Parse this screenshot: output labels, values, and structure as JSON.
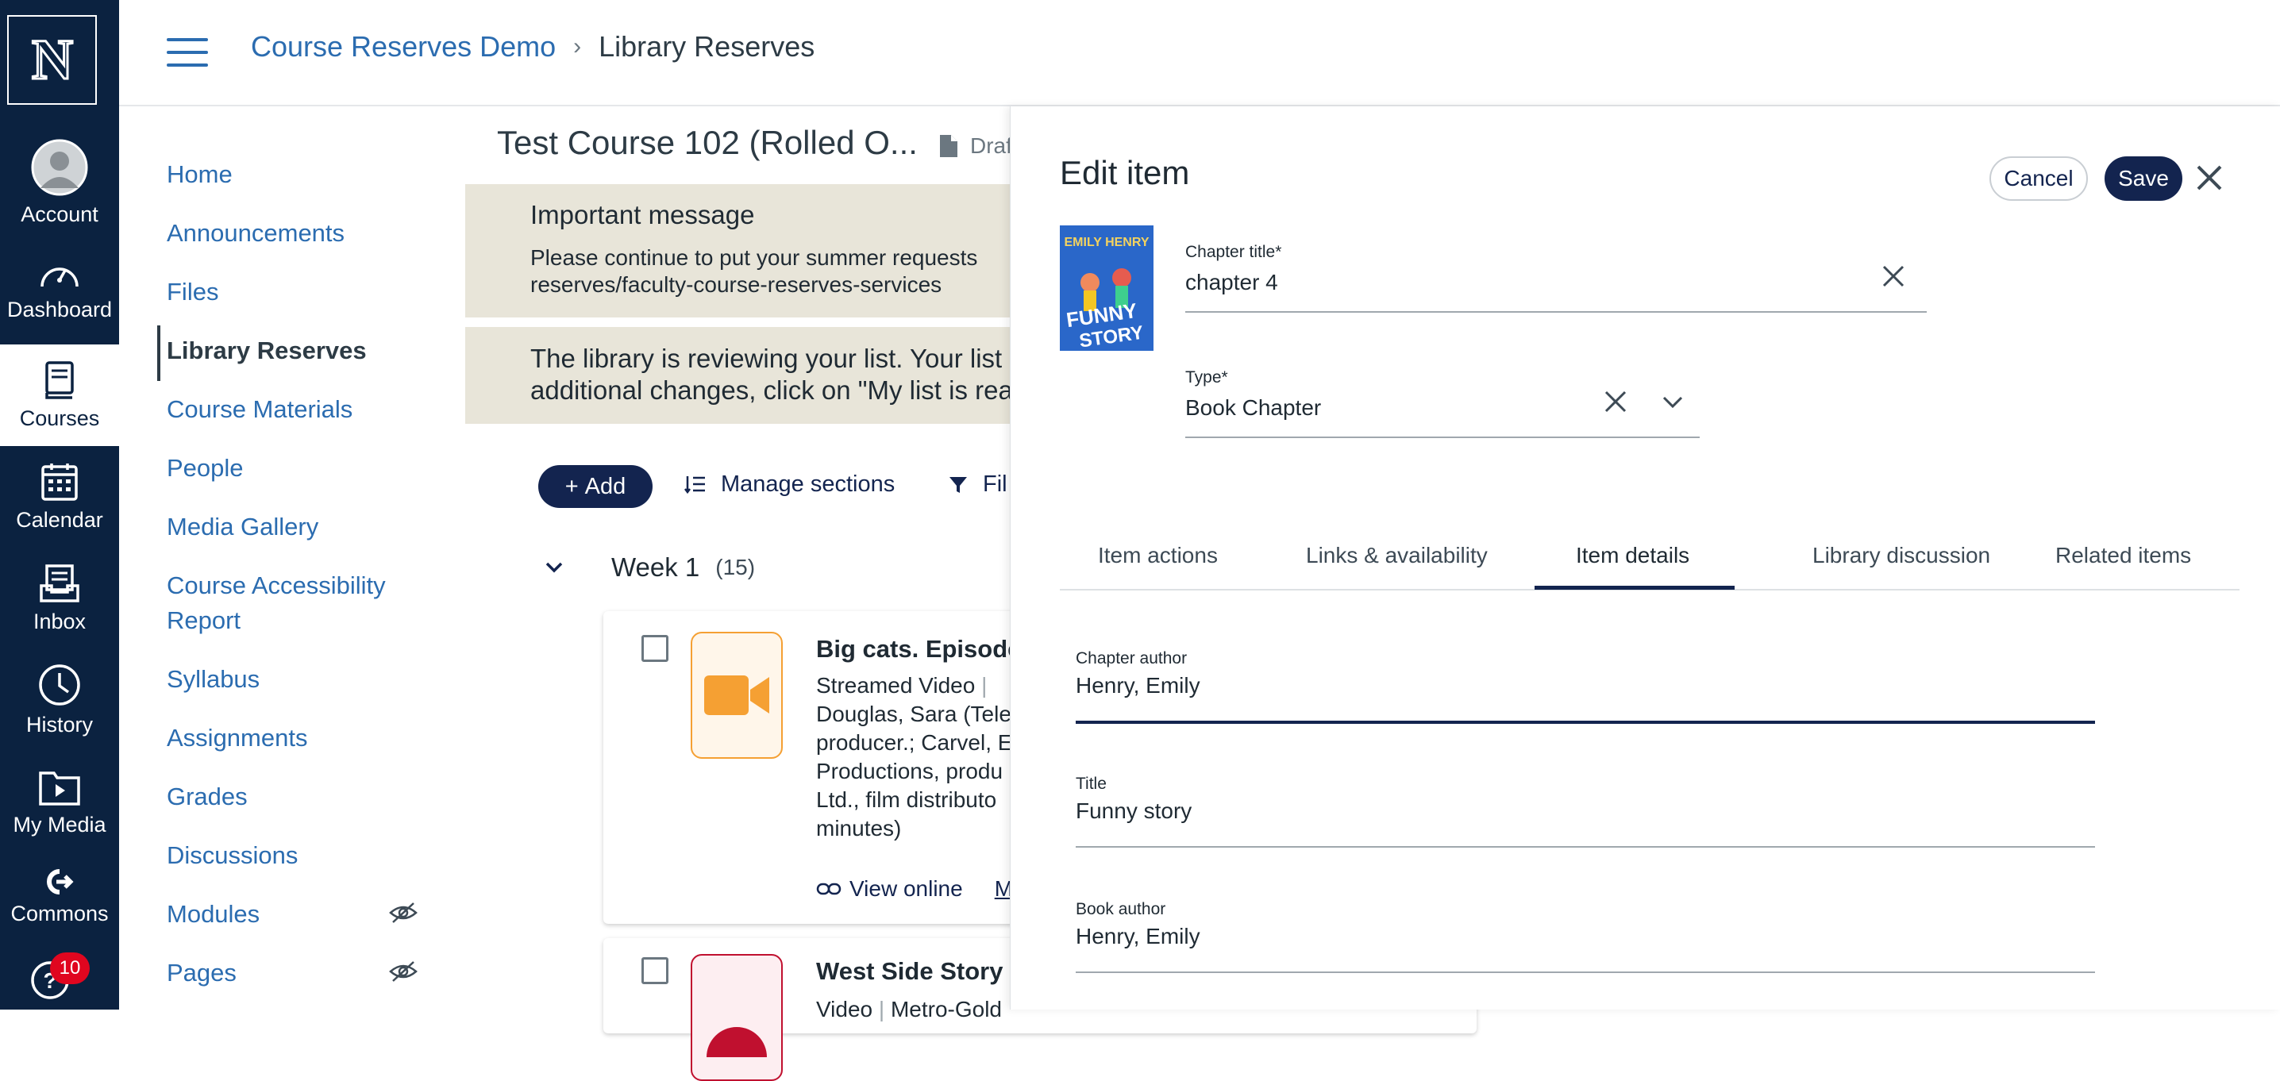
{
  "global_nav": {
    "items": [
      {
        "label": "Account",
        "icon": "account-icon"
      },
      {
        "label": "Dashboard",
        "icon": "dashboard-icon"
      },
      {
        "label": "Courses",
        "icon": "courses-icon"
      },
      {
        "label": "Calendar",
        "icon": "calendar-icon"
      },
      {
        "label": "Inbox",
        "icon": "inbox-icon"
      },
      {
        "label": "History",
        "icon": "history-icon"
      },
      {
        "label": "My Media",
        "icon": "my-media-icon"
      },
      {
        "label": "Commons",
        "icon": "commons-icon"
      }
    ],
    "help_badge": "10"
  },
  "header": {
    "crumb_course": "Course Reserves Demo",
    "crumb_current": "Library Reserves"
  },
  "course_nav": {
    "items": [
      "Home",
      "Announcements",
      "Files",
      "Library Reserves",
      "Course Materials",
      "People",
      "Media Gallery",
      "Course Accessibility Report",
      "Syllabus",
      "Assignments",
      "Grades",
      "Discussions",
      "Modules",
      "Pages"
    ]
  },
  "main": {
    "course_title": "Test Course 102 (Rolled O...",
    "draft_label": "Draft",
    "message1_title": "Important message",
    "message1_line1": "Please continue to put your summer requests",
    "message1_line2": "reserves/faculty-course-reserves-services",
    "message2_line1": "The library is reviewing your list. Your list",
    "message2_line2": "additional changes, click on \"My list is rea",
    "add_label": "Add",
    "manage_sections_label": "Manage sections",
    "filter_label": "Fil",
    "week_label": "Week 1",
    "week_count": "(15)",
    "items": [
      {
        "title": "Big cats. Episode",
        "type": "Streamed Video",
        "meta_lines": [
          "Douglas, Sara (Tele",
          "producer.; Carvel, E",
          "Productions, produ",
          "Ltd., film distributo",
          "minutes)"
        ],
        "link": "View online",
        "link2": "M"
      },
      {
        "title": "West Side Story",
        "type": "Video",
        "meta_fragment": "Metro-Gold"
      }
    ]
  },
  "drawer": {
    "title": "Edit item",
    "cancel_label": "Cancel",
    "save_label": "Save",
    "cover": {
      "author": "EMILY HENRY",
      "title_line1": "FUNNY",
      "title_line2": "STORY"
    },
    "chapter_title_label": "Chapter title*",
    "chapter_title_value": "chapter 4",
    "type_label": "Type*",
    "type_value": "Book Chapter",
    "tabs": [
      "Item actions",
      "Links & availability",
      "Item details",
      "Library discussion",
      "Related items"
    ],
    "active_tab": "Item details",
    "fields": [
      {
        "label": "Chapter author",
        "value": "Henry, Emily"
      },
      {
        "label": "Title",
        "value": "Funny story"
      },
      {
        "label": "Book author",
        "value": "Henry, Emily"
      }
    ]
  },
  "colors": {
    "nav_bg": "#0b2240",
    "link_blue": "#2b6cb0",
    "primary_button": "#13244f",
    "message_bg": "#e8e5d9",
    "badge_red": "#e0061f",
    "video_orange": "#f5a033"
  }
}
